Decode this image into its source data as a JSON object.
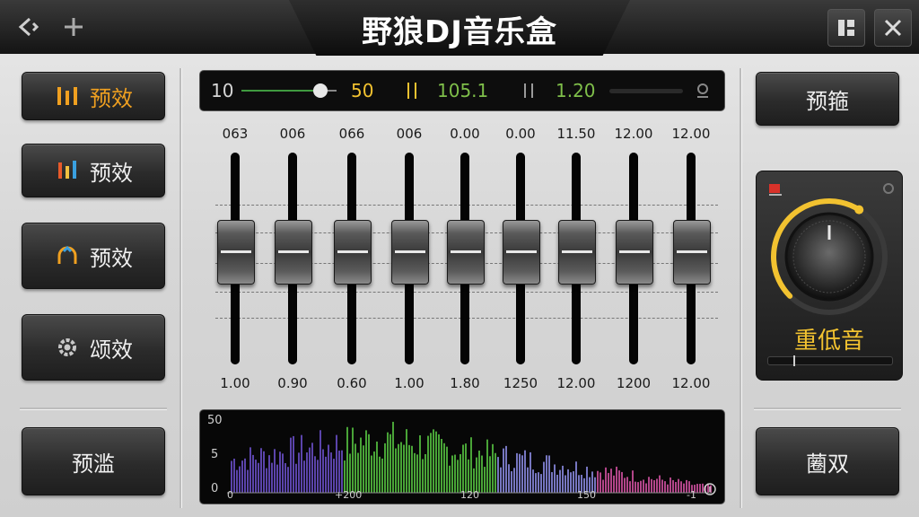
{
  "header": {
    "title": "野狼DJ音乐盒",
    "left_buttons": [
      "back-icon",
      "add-icon"
    ],
    "right_buttons": [
      "layout-icon",
      "close-icon"
    ]
  },
  "left_panel": {
    "buttons": [
      {
        "label": "预效",
        "icon": "equalizer-bars-icon",
        "active": true
      },
      {
        "label": "预效",
        "icon": "color-bars-icon",
        "active": false
      },
      {
        "label": "预效",
        "icon": "loop-icon",
        "active": false
      },
      {
        "label": "颂效",
        "icon": "gear-icon",
        "active": false
      }
    ],
    "bottom_button": "预滥"
  },
  "display_strip": {
    "value_left": "10",
    "value_mid": "50",
    "value_bpm": "105.1",
    "value_right": "1.20"
  },
  "faders": [
    {
      "top": "063",
      "bottom": "1.00",
      "level": 0.55
    },
    {
      "top": "006",
      "bottom": "0.90",
      "level": 0.55
    },
    {
      "top": "066",
      "bottom": "0.60",
      "level": 0.55
    },
    {
      "top": "006",
      "bottom": "1.00",
      "level": 0.55
    },
    {
      "top": "0.00",
      "bottom": "1.80",
      "level": 0.55
    },
    {
      "top": "0.00",
      "bottom": "1250",
      "level": 0.55
    },
    {
      "top": "11.50",
      "bottom": "12.00",
      "level": 0.55
    },
    {
      "top": "12.00",
      "bottom": "1200",
      "level": 0.55
    },
    {
      "top": "12.00",
      "bottom": "12.00",
      "level": 0.55
    }
  ],
  "spectrum": {
    "y_labels": [
      "50",
      "5",
      "0"
    ],
    "x_labels": [
      "0",
      "+200",
      "120",
      "150",
      "-1"
    ]
  },
  "right_panel": {
    "top_button": "预箍",
    "bass_label": "重低音",
    "bass_level": 0.62,
    "bottom_button": "蔨双"
  },
  "colors": {
    "accent_orange": "#f0a020",
    "knob_yellow": "#f2c230",
    "strip_yellow": "#f2c230",
    "strip_green": "#7fbf4a"
  }
}
